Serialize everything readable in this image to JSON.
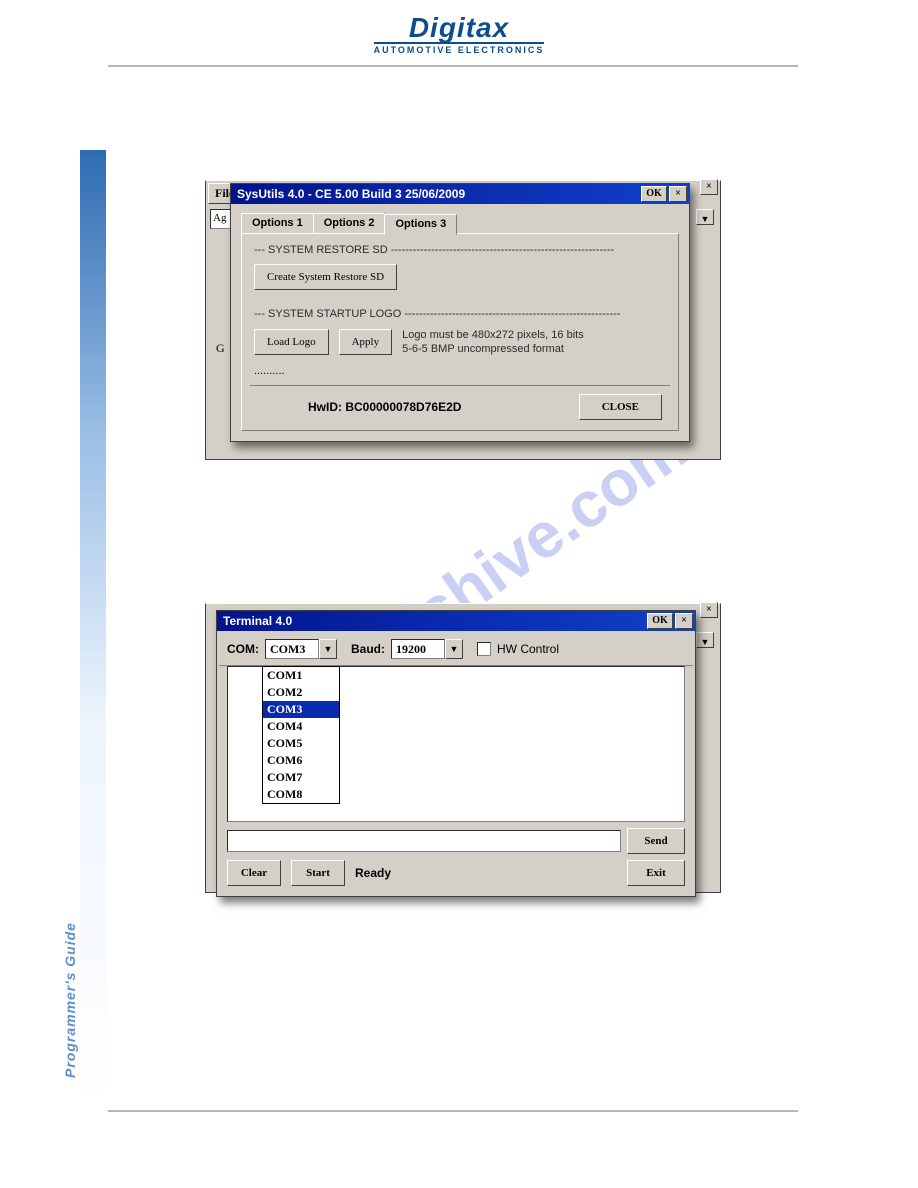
{
  "brand": {
    "name": "Digitax",
    "subtitle": "AUTOMOTIVE ELECTRONICS"
  },
  "sidebar_caption": "Programmer's Guide",
  "behind1": {
    "menu_file": "File",
    "menu_cropped": "Ag",
    "char_g": "G"
  },
  "sysutils": {
    "title": "SysUtils 4.0  -  CE 5.00 Build 3 25/06/2009",
    "ok": "OK",
    "close_x": "×",
    "tabs": {
      "opt1": "Options 1",
      "opt2": "Options 2",
      "opt3": "Options 3"
    },
    "section_restore": "--- SYSTEM RESTORE SD -------------------------------------------------------------",
    "btn_create_restore": "Create System Restore SD",
    "section_logo": "--- SYSTEM STARTUP LOGO -----------------------------------------------------------",
    "btn_load_logo": "Load Logo",
    "btn_apply": "Apply",
    "logo_hint1": "Logo must be 480x272 pixels, 16 bits",
    "logo_hint2": "5-6-5 BMP uncompressed format",
    "dots": "..........",
    "hwid": "HwID: BC00000078D76E2D",
    "btn_close": "CLOSE"
  },
  "terminal": {
    "title": "Terminal 4.0",
    "ok": "OK",
    "close_x": "×",
    "com_label": "COM:",
    "com_value": "COM3",
    "com_options": [
      "COM1",
      "COM2",
      "COM3",
      "COM4",
      "COM5",
      "COM6",
      "COM7",
      "COM8"
    ],
    "baud_label": "Baud:",
    "baud_value": "19200",
    "hw_control": "HW Control",
    "hw_checked": false,
    "btn_send": "Send",
    "btn_clear": "Clear",
    "btn_start": "Start",
    "status": "Ready",
    "btn_exit": "Exit"
  },
  "watermark": "manualshive.com"
}
